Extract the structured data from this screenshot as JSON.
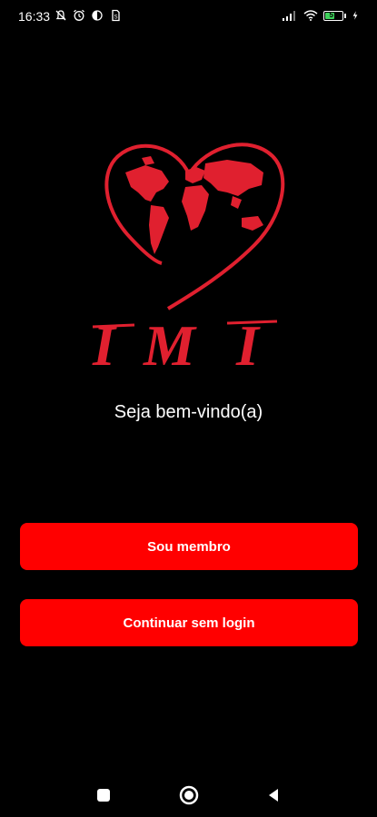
{
  "status_bar": {
    "time": "16:33",
    "battery_level": "57",
    "left_icons": [
      "muted-notification-icon",
      "alarm-icon",
      "data-saver-icon",
      "sim-icon"
    ],
    "right_icons": [
      "signal-icon",
      "wifi-icon",
      "battery-icon",
      "charging-icon"
    ]
  },
  "logo": {
    "text": "IMI",
    "accent_color": "#e0202f"
  },
  "welcome": {
    "text": "Seja bem-vindo(a)"
  },
  "buttons": {
    "member_label": "Sou membro",
    "guest_label": "Continuar sem login",
    "color": "#ff0000"
  },
  "nav_bar": {
    "items": [
      "recents-icon",
      "home-icon",
      "back-icon"
    ]
  }
}
